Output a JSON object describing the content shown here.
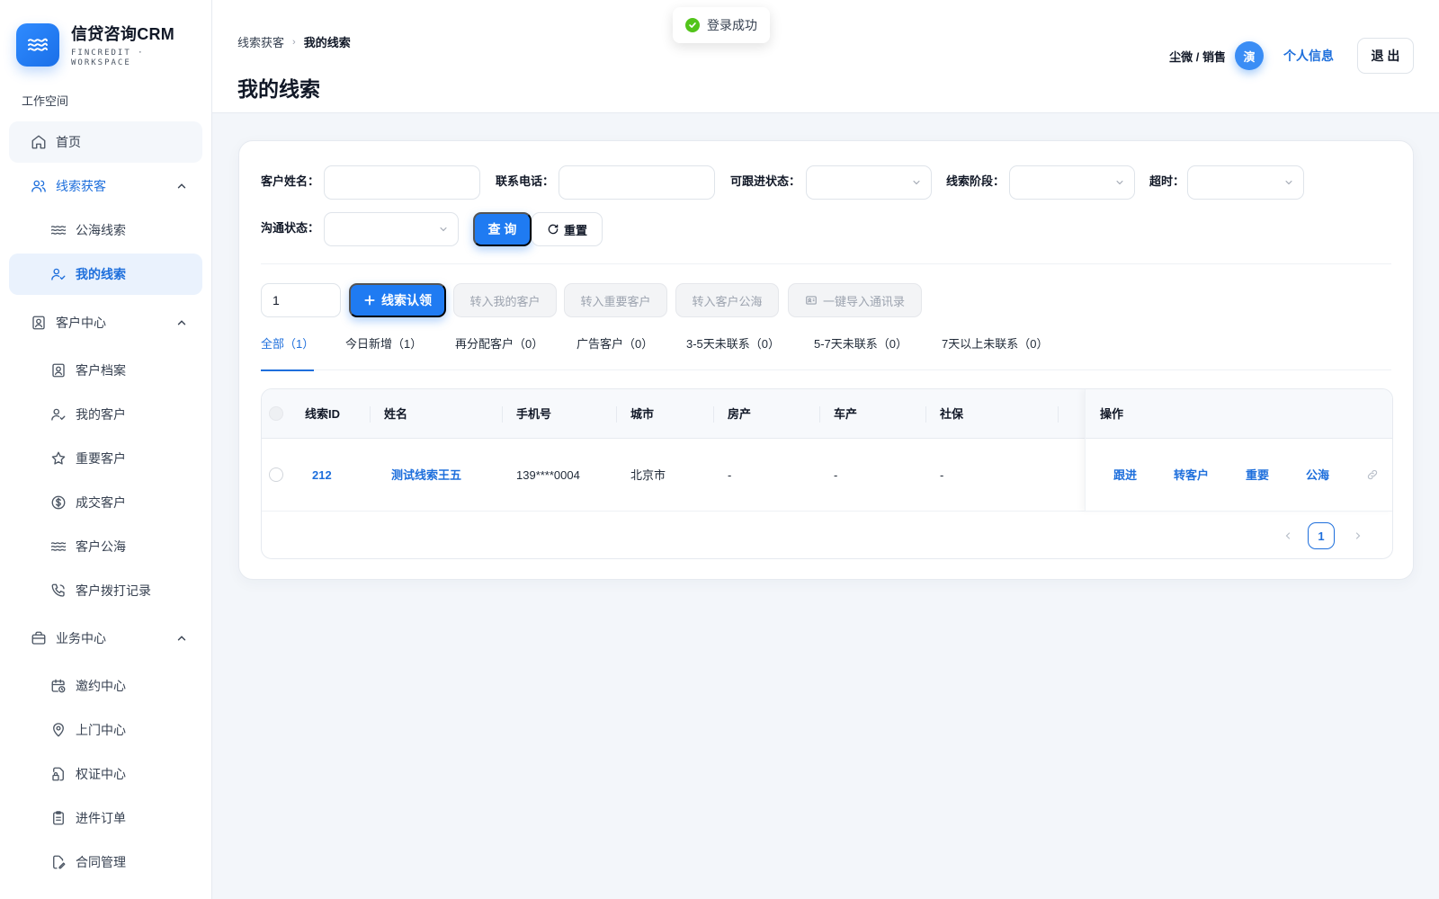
{
  "brand": {
    "title": "信贷咨询CRM",
    "subtitle": "FINCREDIT · WORKSPACE"
  },
  "sidebar": {
    "section_label": "工作空间",
    "items": [
      {
        "label": "首页",
        "icon": "home-icon"
      },
      {
        "label": "线索获客",
        "icon": "users-icon",
        "expanded": true
      },
      {
        "label": "公海线索",
        "icon": "waves-icon"
      },
      {
        "label": "我的线索",
        "icon": "user-check-icon",
        "active": true
      },
      {
        "label": "客户中心",
        "icon": "contact-card-icon",
        "expanded": true
      },
      {
        "label": "客户档案",
        "icon": "contact-card-icon"
      },
      {
        "label": "我的客户",
        "icon": "user-check-icon"
      },
      {
        "label": "重要客户",
        "icon": "star-icon"
      },
      {
        "label": "成交客户",
        "icon": "dollar-circle-icon"
      },
      {
        "label": "客户公海",
        "icon": "waves-icon"
      },
      {
        "label": "客户拨打记录",
        "icon": "phone-icon"
      },
      {
        "label": "业务中心",
        "icon": "briefcase-icon",
        "expanded": true
      },
      {
        "label": "邀约中心",
        "icon": "calendar-clock-icon"
      },
      {
        "label": "上门中心",
        "icon": "map-pin-icon"
      },
      {
        "label": "权证中心",
        "icon": "file-lock-icon"
      },
      {
        "label": "进件订单",
        "icon": "clipboard-icon"
      },
      {
        "label": "合同管理",
        "icon": "file-edit-icon"
      }
    ]
  },
  "header": {
    "breadcrumb": [
      "线索获客",
      "我的线索"
    ],
    "breadcrumb_sep": "›",
    "title": "我的线索",
    "user_name": "尘微 / 销售",
    "avatar_text": "演",
    "profile_link": "个人信息",
    "logout": "退 出"
  },
  "toast": {
    "text": "登录成功",
    "status_color": "#52c41a"
  },
  "filters": {
    "customer_name": {
      "label": "客户姓名：",
      "value": ""
    },
    "phone": {
      "label": "联系电话：",
      "value": ""
    },
    "follow_status": {
      "label": "可跟进状态：",
      "value": ""
    },
    "lead_stage": {
      "label": "线索阶段：",
      "value": ""
    },
    "timeout": {
      "label": "超时：",
      "value": ""
    },
    "comm_status": {
      "label": "沟通状态：",
      "value": ""
    },
    "query_button": "查 询",
    "reset_button": "重置"
  },
  "actions": {
    "quantity_value": "1",
    "claim_button": "线索认领",
    "to_my_customer": "转入我的客户",
    "to_important": "转入重要客户",
    "to_customer_pool": "转入客户公海",
    "import_contacts": "一键导入通讯录"
  },
  "tabs": [
    {
      "label": "全部（1）",
      "active": true
    },
    {
      "label": "今日新增（1）"
    },
    {
      "label": "再分配客户（0）"
    },
    {
      "label": "广告客户（0）"
    },
    {
      "label": "3-5天未联系（0）"
    },
    {
      "label": "5-7天未联系（0）"
    },
    {
      "label": "7天以上未联系（0）"
    }
  ],
  "table": {
    "columns": [
      "线索ID",
      "姓名",
      "手机号",
      "城市",
      "房产",
      "车产",
      "社保",
      "操作"
    ],
    "rows": [
      {
        "id": "212",
        "name": "测试线索王五",
        "phone": "139****0004",
        "city": "北京市",
        "house": "-",
        "car": "-",
        "social": "-"
      }
    ],
    "row_actions": [
      "跟进",
      "转客户",
      "重要",
      "公海"
    ]
  },
  "pagination": {
    "current_page": "1"
  },
  "colors": {
    "accent": "#1f7bf2",
    "link": "#1e6fdc",
    "active_bg": "#eaf2fd"
  }
}
